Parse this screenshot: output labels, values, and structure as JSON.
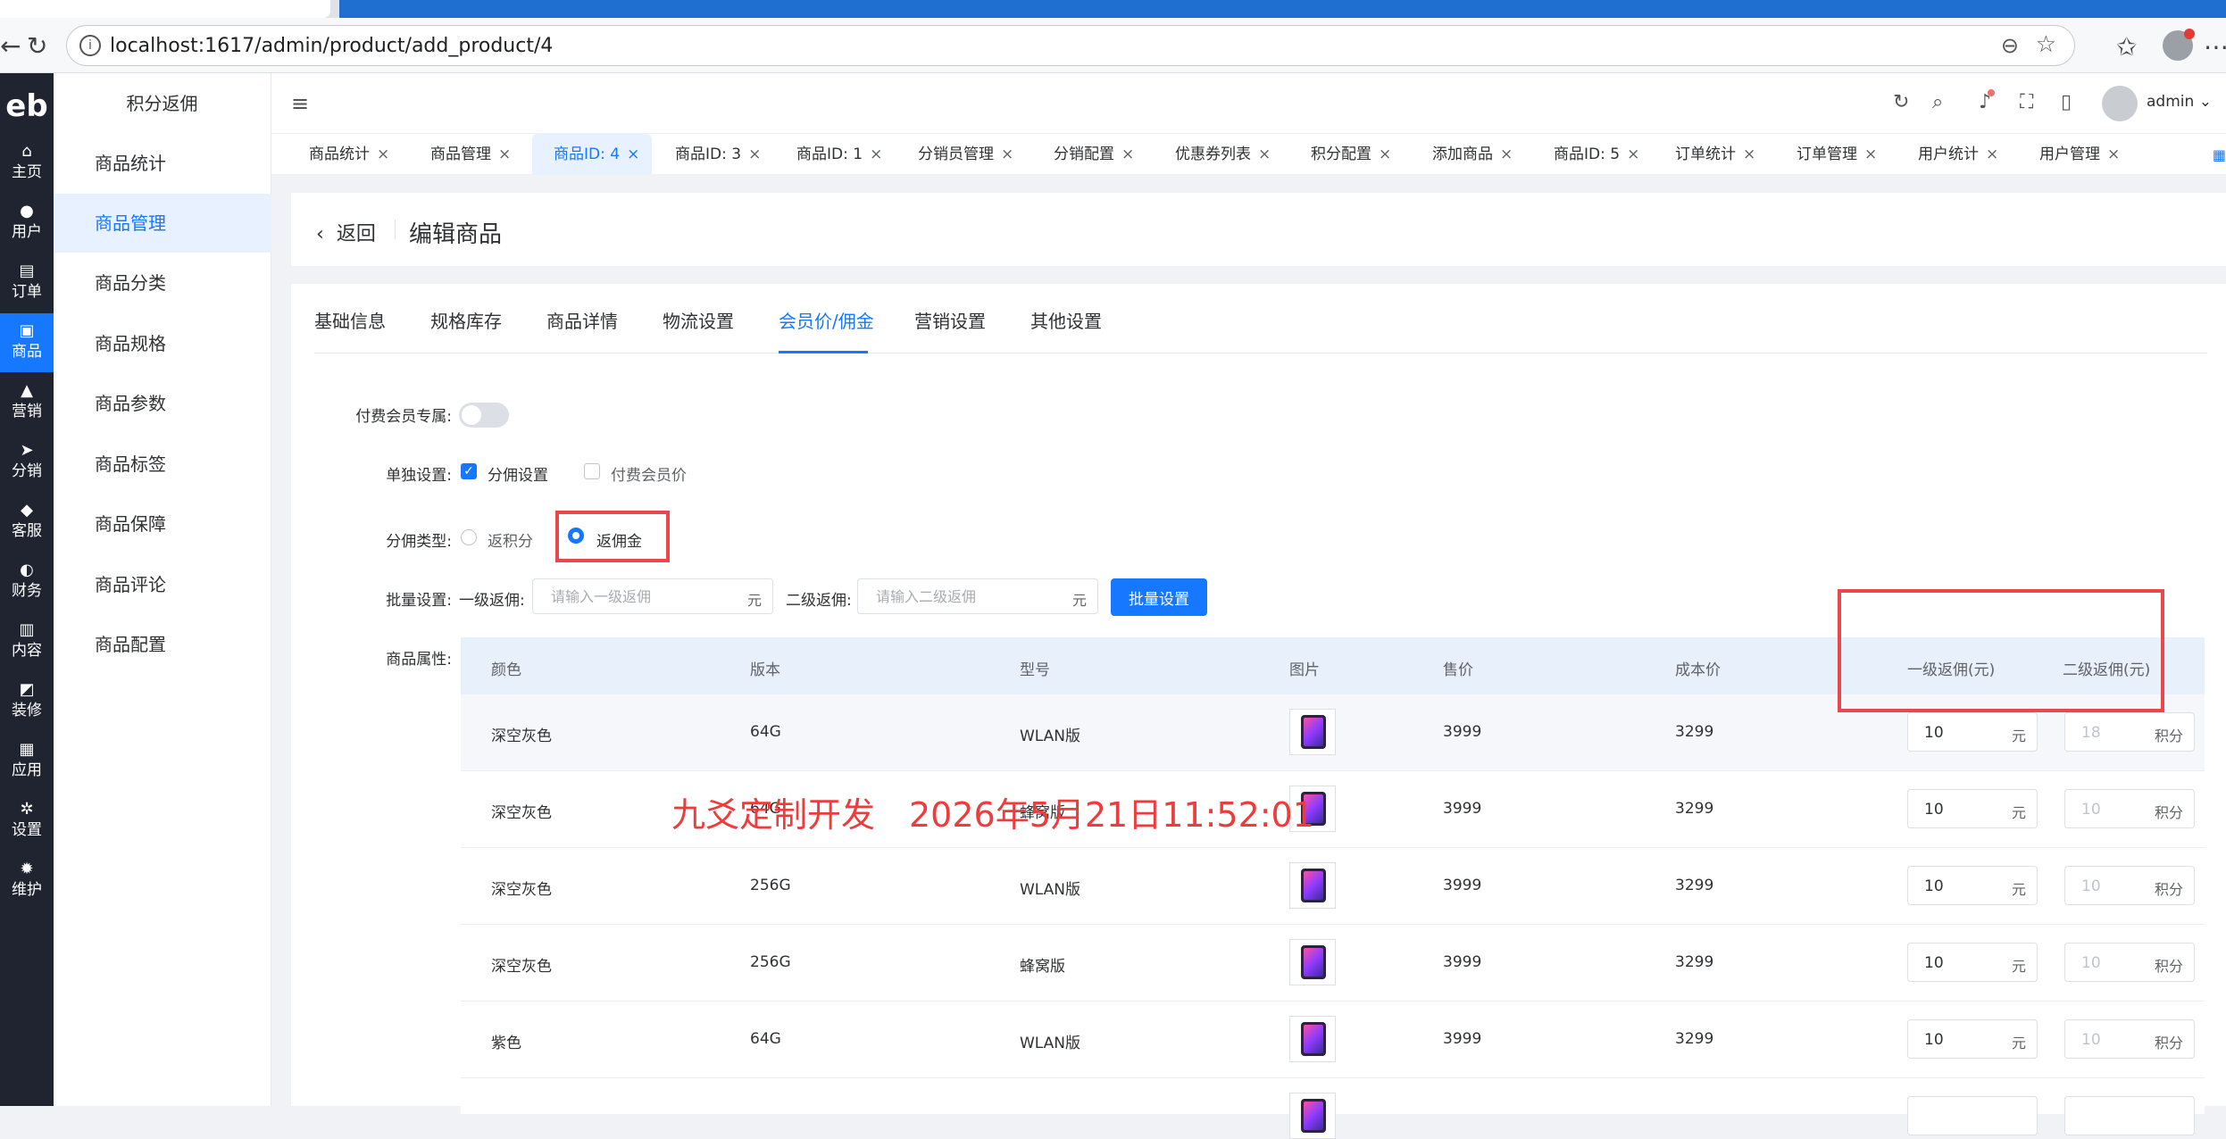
{
  "browser": {
    "url": "localhost:1617/admin/product/add_product/4"
  },
  "iconbar": {
    "logo": "eb",
    "items": [
      {
        "label": "主页",
        "glyph": "⌂"
      },
      {
        "label": "用户",
        "glyph": "●"
      },
      {
        "label": "订单",
        "glyph": "▤"
      },
      {
        "label": "商品",
        "glyph": "▣"
      },
      {
        "label": "营销",
        "glyph": "▲"
      },
      {
        "label": "分销",
        "glyph": "➤"
      },
      {
        "label": "客服",
        "glyph": "◆"
      },
      {
        "label": "财务",
        "glyph": "◐"
      },
      {
        "label": "内容",
        "glyph": "▥"
      },
      {
        "label": "装修",
        "glyph": "◩"
      },
      {
        "label": "应用",
        "glyph": "▦"
      },
      {
        "label": "设置",
        "glyph": "✲"
      },
      {
        "label": "维护",
        "glyph": "✹"
      }
    ],
    "active_index": 3
  },
  "submenu": {
    "title": "积分返佣",
    "items": [
      "商品统计",
      "商品管理",
      "商品分类",
      "商品规格",
      "商品参数",
      "商品标签",
      "商品保障",
      "商品评论",
      "商品配置"
    ],
    "active_index": 1
  },
  "header": {
    "username": "admin"
  },
  "tags": [
    {
      "label": "商品统计",
      "x": "×"
    },
    {
      "label": "商品管理",
      "x": "×"
    },
    {
      "label": "商品ID: 4",
      "x": "×"
    },
    {
      "label": "商品ID: 3",
      "x": "×"
    },
    {
      "label": "商品ID: 1",
      "x": "×"
    },
    {
      "label": "分销员管理",
      "x": "×"
    },
    {
      "label": "分销配置",
      "x": "×"
    },
    {
      "label": "优惠券列表",
      "x": "×"
    },
    {
      "label": "积分配置",
      "x": "×"
    },
    {
      "label": "添加商品",
      "x": "×"
    },
    {
      "label": "商品ID: 5",
      "x": "×"
    },
    {
      "label": "订单统计",
      "x": "×"
    },
    {
      "label": "订单管理",
      "x": "×"
    },
    {
      "label": "用户统计",
      "x": "×"
    },
    {
      "label": "用户管理",
      "x": "×"
    }
  ],
  "page": {
    "back": "返回",
    "title": "编辑商品"
  },
  "product_tabs": [
    "基础信息",
    "规格库存",
    "商品详情",
    "物流设置",
    "会员价/佣金",
    "营销设置",
    "其他设置"
  ],
  "form": {
    "paid_member_label": "付费会员专属:",
    "single_label": "单独设置:",
    "single_opt1": "分佣设置",
    "single_opt2": "付费会员价",
    "type_label": "分佣类型:",
    "type_opt1": "返积分",
    "type_opt2": "返佣金",
    "batch_label": "批量设置:",
    "lvl1_label": "一级返佣:",
    "lvl1_placeholder": "请输入一级返佣",
    "lvl2_label": "二级返佣:",
    "lvl2_placeholder": "请输入二级返佣",
    "unit_yuan": "元",
    "batch_button": "批量设置",
    "attr_label": "商品属性:"
  },
  "table": {
    "headers": [
      "颜色",
      "版本",
      "型号",
      "图片",
      "售价",
      "成本价",
      "一级返佣(元)",
      "二级返佣(元)"
    ],
    "unit1": "元",
    "unit2": "积分",
    "rows": [
      {
        "color": "深空灰色",
        "version": "64G",
        "model": "WLAN版",
        "price": "3999",
        "cost": "3299",
        "l1": "10",
        "l2": "18"
      },
      {
        "color": "深空灰色",
        "version": "64G",
        "model": "蜂窝版",
        "price": "3999",
        "cost": "3299",
        "l1": "10",
        "l2": "10"
      },
      {
        "color": "深空灰色",
        "version": "256G",
        "model": "WLAN版",
        "price": "3999",
        "cost": "3299",
        "l1": "10",
        "l2": "10"
      },
      {
        "color": "深空灰色",
        "version": "256G",
        "model": "蜂窝版",
        "price": "3999",
        "cost": "3299",
        "l1": "10",
        "l2": "10"
      },
      {
        "color": "紫色",
        "version": "64G",
        "model": "WLAN版",
        "price": "3999",
        "cost": "3299",
        "l1": "10",
        "l2": "10"
      }
    ]
  },
  "watermark": "九爻定制开发　2026年5月21日11:52:01"
}
